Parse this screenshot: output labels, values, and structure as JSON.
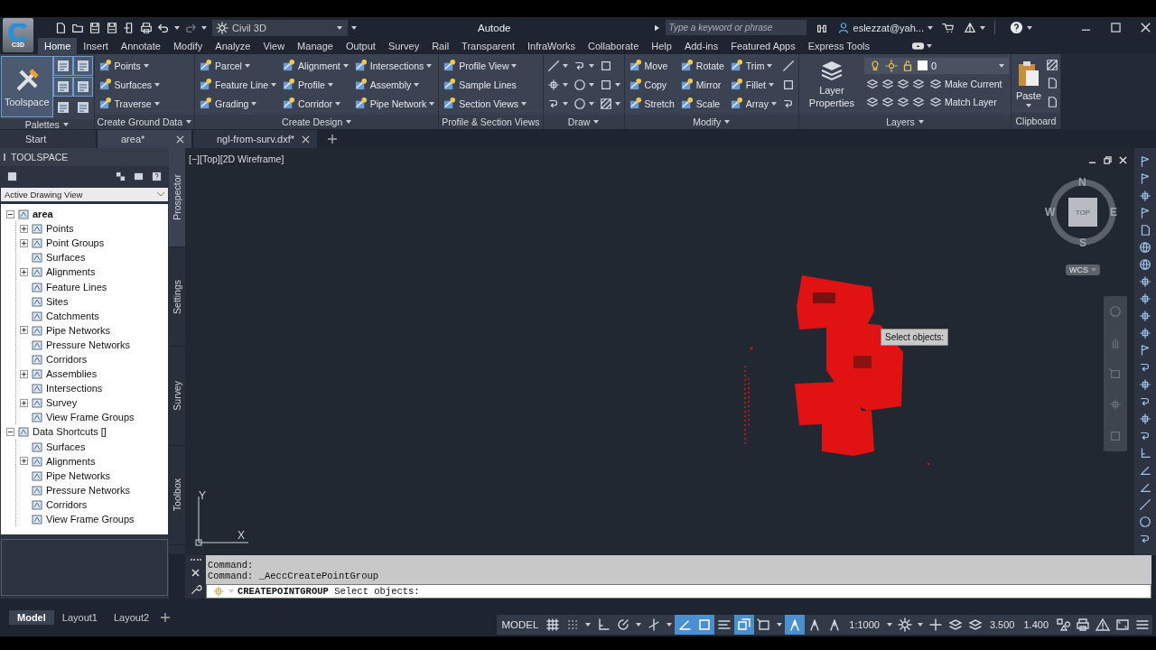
{
  "app_button": {
    "label": "C3D"
  },
  "title_bar": {
    "workspace": "Civil 3D",
    "title": "Autode",
    "search": {
      "placeholder": "Type a keyword or phrase"
    },
    "user": "eslezzat@yah..."
  },
  "ribbon_tabs": [
    {
      "label": "Home",
      "selected": true
    },
    {
      "label": "Insert",
      "selected": false
    },
    {
      "label": "Annotate",
      "selected": false
    },
    {
      "label": "Modify",
      "selected": false
    },
    {
      "label": "Analyze",
      "selected": false
    },
    {
      "label": "View",
      "selected": false
    },
    {
      "label": "Manage",
      "selected": false
    },
    {
      "label": "Output",
      "selected": false
    },
    {
      "label": "Survey",
      "selected": false
    },
    {
      "label": "Rail",
      "selected": false
    },
    {
      "label": "Transparent",
      "selected": false
    },
    {
      "label": "InfraWorks",
      "selected": false
    },
    {
      "label": "Collaborate",
      "selected": false
    },
    {
      "label": "Help",
      "selected": false
    },
    {
      "label": "Add-ins",
      "selected": false
    },
    {
      "label": "Featured Apps",
      "selected": false
    },
    {
      "label": "Express Tools",
      "selected": false
    }
  ],
  "ribbon_panels": [
    {
      "kind": "palettes",
      "title": "Palettes",
      "title_menu": true,
      "big": {
        "label": "Toolspace",
        "on": true
      },
      "toggles": [
        {
          "on": true
        },
        {
          "on": true
        },
        {
          "on": true
        },
        {
          "on": true
        },
        {
          "on": false
        },
        {
          "on": false
        }
      ]
    },
    {
      "kind": "commands",
      "title": "Create Ground Data",
      "title_menu": true,
      "columns": [
        [
          {
            "label": "Points",
            "dropdown": true
          },
          {
            "label": "Surfaces",
            "dropdown": true
          },
          {
            "label": "Traverse",
            "dropdown": true
          }
        ]
      ]
    },
    {
      "kind": "commands",
      "title": "Create Design",
      "title_menu": true,
      "columns": [
        [
          {
            "label": "Parcel",
            "dropdown": true
          },
          {
            "label": "Feature Line",
            "dropdown": true
          },
          {
            "label": "Grading",
            "dropdown": true
          }
        ],
        [
          {
            "label": "Alignment",
            "dropdown": true
          },
          {
            "label": "Profile",
            "dropdown": true
          },
          {
            "label": "Corridor",
            "dropdown": true
          }
        ],
        [
          {
            "label": "Intersections",
            "dropdown": true
          },
          {
            "label": "Assembly",
            "dropdown": true
          },
          {
            "label": "Pipe Network",
            "dropdown": true
          }
        ]
      ]
    },
    {
      "kind": "commands",
      "title": "Profile & Section Views",
      "title_menu": false,
      "columns": [
        [
          {
            "label": "Profile View",
            "dropdown": true
          },
          {
            "label": "Sample Lines",
            "dropdown": false
          },
          {
            "label": "Section Views",
            "dropdown": true
          }
        ]
      ]
    },
    {
      "kind": "commands",
      "title": "Draw",
      "title_menu": true,
      "columns": [
        [
          {
            "dropdown": true
          },
          {
            "dropdown": true
          },
          {
            "dropdown": true
          }
        ],
        [
          {
            "dropdown": true
          },
          {
            "dropdown": true
          },
          {
            "dropdown": true
          }
        ],
        [
          {
            "dropdown": false
          },
          {
            "dropdown": true
          },
          {
            "dropdown": true
          }
        ]
      ]
    },
    {
      "kind": "commands",
      "title": "Modify",
      "title_menu": true,
      "columns": [
        [
          {
            "label": "Move",
            "dropdown": false
          },
          {
            "label": "Copy",
            "dropdown": false
          },
          {
            "label": "Stretch",
            "dropdown": false
          }
        ],
        [
          {
            "label": "Rotate",
            "dropdown": false
          },
          {
            "label": "Mirror",
            "dropdown": false
          },
          {
            "label": "Scale",
            "dropdown": false
          }
        ],
        [
          {
            "label": "Trim",
            "dropdown": true
          },
          {
            "label": "Fillet",
            "dropdown": true
          },
          {
            "label": "Array",
            "dropdown": true
          }
        ],
        [
          {
            "dropdown": false
          },
          {
            "dropdown": false
          },
          {
            "dropdown": false
          }
        ]
      ]
    },
    {
      "kind": "layers",
      "title": "Layers",
      "title_menu": true,
      "big": {
        "label": "Layer Properties"
      },
      "layer": "0",
      "actions": [
        {
          "label": "Make Current"
        },
        {
          "label": "Match Layer"
        }
      ]
    },
    {
      "kind": "clipboard",
      "title": "Clipboard",
      "title_menu": false,
      "big": {
        "label": "Paste"
      }
    }
  ],
  "file_tabs": [
    {
      "label": "Start",
      "selected": false,
      "closable": false
    },
    {
      "label": "area*",
      "selected": true,
      "closable": true
    },
    {
      "label": "ngl-from-surv.dxf*",
      "selected": false,
      "closable": true
    }
  ],
  "toolspace": {
    "title": "TOOLSPACE",
    "view": "Active Drawing View",
    "tree": [
      {
        "label": "area",
        "bold": true,
        "expandable": true,
        "expanded": true,
        "children": [
          {
            "label": "Points",
            "expandable": true,
            "expanded": false
          },
          {
            "label": "Point Groups",
            "expandable": true,
            "expanded": false
          },
          {
            "label": "Surfaces",
            "expandable": false
          },
          {
            "label": "Alignments",
            "expandable": true,
            "expanded": false
          },
          {
            "label": "Feature Lines",
            "expandable": false
          },
          {
            "label": "Sites",
            "expandable": false
          },
          {
            "label": "Catchments",
            "expandable": false
          },
          {
            "label": "Pipe Networks",
            "expandable": true,
            "expanded": false
          },
          {
            "label": "Pressure Networks",
            "expandable": false
          },
          {
            "label": "Corridors",
            "expandable": false
          },
          {
            "label": "Assemblies",
            "expandable": true,
            "expanded": false
          },
          {
            "label": "Intersections",
            "expandable": false
          },
          {
            "label": "Survey",
            "expandable": true,
            "expanded": false
          },
          {
            "label": "View Frame Groups",
            "expandable": false
          }
        ]
      },
      {
        "label": "Data Shortcuts []",
        "bold": false,
        "expandable": true,
        "expanded": true,
        "children": [
          {
            "label": "Surfaces",
            "expandable": false
          },
          {
            "label": "Alignments",
            "expandable": true,
            "expanded": false
          },
          {
            "label": "Pipe Networks",
            "expandable": false
          },
          {
            "label": "Pressure Networks",
            "expandable": false
          },
          {
            "label": "Corridors",
            "expandable": false
          },
          {
            "label": "View Frame Groups",
            "expandable": false
          }
        ]
      }
    ]
  },
  "side_tabs": [
    {
      "label": "Prospector",
      "selected": true
    },
    {
      "label": "Settings",
      "selected": false
    },
    {
      "label": "Survey",
      "selected": false
    },
    {
      "label": "Toolbox",
      "selected": false
    }
  ],
  "viewport": {
    "label": "[−][Top][2D Wireframe]",
    "viewcube": {
      "top": "TOP",
      "north": "N",
      "south": "S",
      "east": "E",
      "west": "W",
      "ucs": "WCS"
    },
    "tooltip": "Select objects:",
    "axes": {
      "x": "X",
      "y": "Y"
    }
  },
  "command_line": {
    "history": [
      "Command:",
      "Command: _AeccCreatePointGroup"
    ],
    "prompt": "**CREATEPOINTGROUP** Select objects:"
  },
  "layout_tabs": [
    {
      "label": "Model",
      "selected": true
    },
    {
      "label": "Layout1",
      "selected": false
    },
    {
      "label": "Layout2",
      "selected": false
    }
  ],
  "status_bar": [
    {
      "kind": "text",
      "label": "MODEL"
    },
    {
      "kind": "toggle",
      "on": false
    },
    {
      "kind": "toggle",
      "on": false
    },
    {
      "kind": "caret"
    },
    {
      "kind": "toggle",
      "on": false
    },
    {
      "kind": "toggle",
      "on": false
    },
    {
      "kind": "caret"
    },
    {
      "kind": "toggle",
      "on": false
    },
    {
      "kind": "caret"
    },
    {
      "kind": "toggle",
      "on": true
    },
    {
      "kind": "toggle",
      "on": true
    },
    {
      "kind": "toggle",
      "on": false
    },
    {
      "kind": "toggle",
      "on": true
    },
    {
      "kind": "toggle",
      "on": false
    },
    {
      "kind": "caret"
    },
    {
      "kind": "toggle",
      "on": true
    },
    {
      "kind": "toggle",
      "on": false
    },
    {
      "kind": "toggle",
      "on": false
    },
    {
      "kind": "text",
      "label": "1:1000"
    },
    {
      "kind": "caret"
    },
    {
      "kind": "toggle",
      "on": false
    },
    {
      "kind": "caret"
    },
    {
      "kind": "toggle",
      "on": false
    },
    {
      "kind": "toggle",
      "on": false
    },
    {
      "kind": "toggle",
      "on": false
    },
    {
      "kind": "text",
      "label": "3.500"
    },
    {
      "kind": "text",
      "label": "1.400"
    },
    {
      "kind": "toggle",
      "on": false
    },
    {
      "kind": "toggle",
      "on": false
    },
    {
      "kind": "toggle",
      "on": false
    },
    {
      "kind": "toggle",
      "on": false
    },
    {
      "kind": "toggle",
      "on": false
    }
  ]
}
